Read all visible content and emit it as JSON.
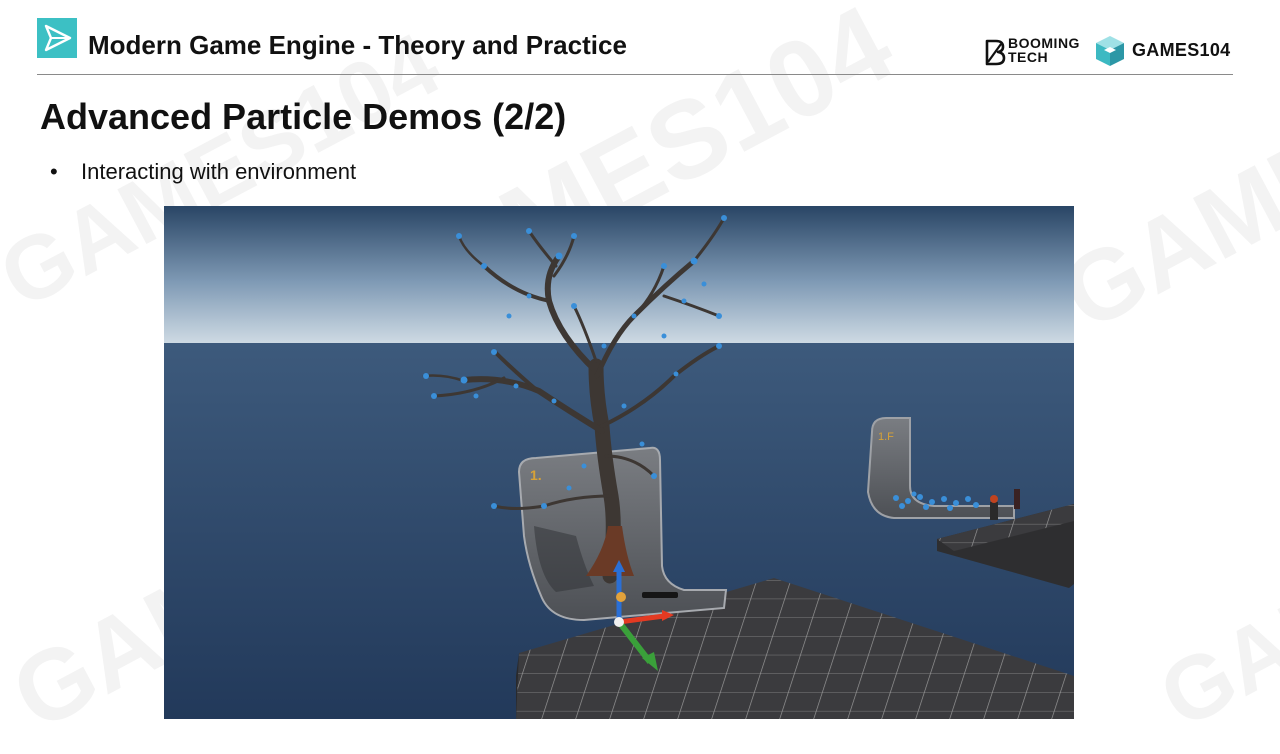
{
  "header": {
    "title": "Modern Game Engine - Theory and Practice",
    "brand_booming_line1": "BOOMING",
    "brand_booming_line2": "TECH",
    "brand_games": "GAMES104",
    "accent_color": "#3cc0c4"
  },
  "slide": {
    "title": "Advanced Particle Demos (2/2)",
    "bullets": [
      "Interacting with environment"
    ]
  },
  "demo": {
    "panel_labels": [
      "1.",
      "1.F"
    ],
    "colors": {
      "sky": "#a9bdd0",
      "ground": "#2f4a6e",
      "particle": "#3a8fd9",
      "tree": "#3a3632",
      "floor": "#3c3c3c",
      "gizmo_x": "#e33a22",
      "gizmo_y": "#3aa03a",
      "gizmo_z": "#2a6fd6"
    }
  }
}
